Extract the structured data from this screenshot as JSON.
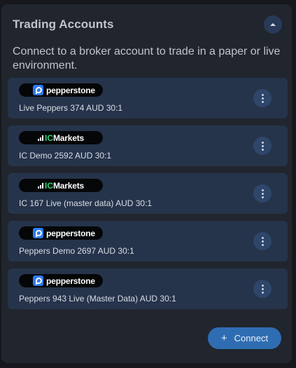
{
  "panel": {
    "title": "Trading Accounts",
    "description": "Connect to a broker account to trade in a paper or live environment."
  },
  "accounts": [
    {
      "broker": "pepperstone",
      "logo_text": "pepperstone",
      "name": "Live Peppers 374 AUD 30:1"
    },
    {
      "broker": "icmarkets",
      "logo_ic": "IC",
      "logo_text": "Markets",
      "name": "IC Demo 2592 AUD 30:1"
    },
    {
      "broker": "icmarkets",
      "logo_ic": "IC",
      "logo_text": "Markets",
      "name": "IC 167 Live (master data) AUD 30:1"
    },
    {
      "broker": "pepperstone",
      "logo_text": "pepperstone",
      "name": "Peppers Demo 2697 AUD 30:1"
    },
    {
      "broker": "pepperstone",
      "logo_text": "pepperstone",
      "name": "Peppers 943 Live (Master Data) AUD 30:1"
    }
  ],
  "connect_button": {
    "icon": "+",
    "label": "Connect"
  },
  "colors": {
    "panel_bg": "#21252d",
    "card_bg": "#26344b",
    "accent": "#2f6db3",
    "pepperstone_blue": "#2d7bf0",
    "icmarkets_green": "#2fd36b"
  }
}
